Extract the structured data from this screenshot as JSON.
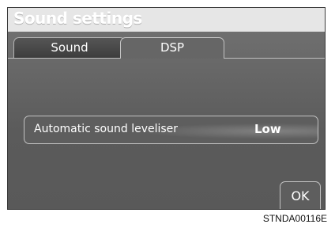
{
  "screen": {
    "title": "Sound settings",
    "tabs": [
      {
        "label": "Sound",
        "selected": false
      },
      {
        "label": "DSP",
        "selected": true
      }
    ],
    "settings": [
      {
        "label": "Automatic sound leveliser",
        "value": "Low"
      }
    ],
    "ok_label": "OK"
  },
  "caption": "STNDA00116E",
  "colors": {
    "screen_background": "#5b5b5b",
    "text": "#ffffff",
    "border": "#c2c2c2"
  }
}
